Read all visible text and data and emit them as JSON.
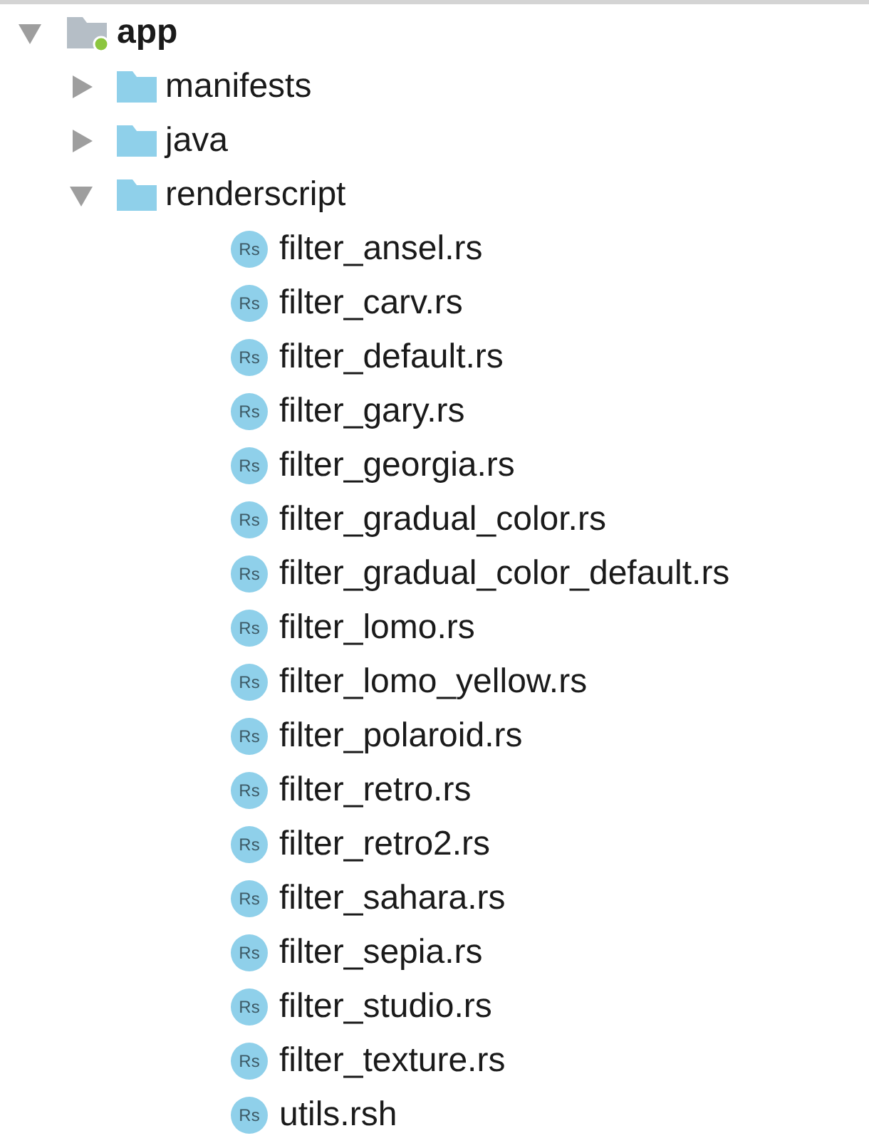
{
  "tree": [
    {
      "kind": "module",
      "label": "app",
      "expanded": true,
      "children": [
        {
          "kind": "folder",
          "label": "manifests",
          "expanded": false
        },
        {
          "kind": "folder",
          "label": "java",
          "expanded": false
        },
        {
          "kind": "folder",
          "label": "renderscript",
          "expanded": true,
          "children": [
            {
              "kind": "file",
              "label": "filter_ansel.rs",
              "badge": "Rs"
            },
            {
              "kind": "file",
              "label": "filter_carv.rs",
              "badge": "Rs"
            },
            {
              "kind": "file",
              "label": "filter_default.rs",
              "badge": "Rs"
            },
            {
              "kind": "file",
              "label": "filter_gary.rs",
              "badge": "Rs"
            },
            {
              "kind": "file",
              "label": "filter_georgia.rs",
              "badge": "Rs"
            },
            {
              "kind": "file",
              "label": "filter_gradual_color.rs",
              "badge": "Rs"
            },
            {
              "kind": "file",
              "label": "filter_gradual_color_default.rs",
              "badge": "Rs"
            },
            {
              "kind": "file",
              "label": "filter_lomo.rs",
              "badge": "Rs"
            },
            {
              "kind": "file",
              "label": "filter_lomo_yellow.rs",
              "badge": "Rs"
            },
            {
              "kind": "file",
              "label": "filter_polaroid.rs",
              "badge": "Rs"
            },
            {
              "kind": "file",
              "label": "filter_retro.rs",
              "badge": "Rs"
            },
            {
              "kind": "file",
              "label": "filter_retro2.rs",
              "badge": "Rs"
            },
            {
              "kind": "file",
              "label": "filter_sahara.rs",
              "badge": "Rs"
            },
            {
              "kind": "file",
              "label": "filter_sepia.rs",
              "badge": "Rs"
            },
            {
              "kind": "file",
              "label": "filter_studio.rs",
              "badge": "Rs"
            },
            {
              "kind": "file",
              "label": "filter_texture.rs",
              "badge": "Rs"
            },
            {
              "kind": "file",
              "label": "utils.rsh",
              "badge": "Rs"
            }
          ]
        }
      ]
    }
  ]
}
